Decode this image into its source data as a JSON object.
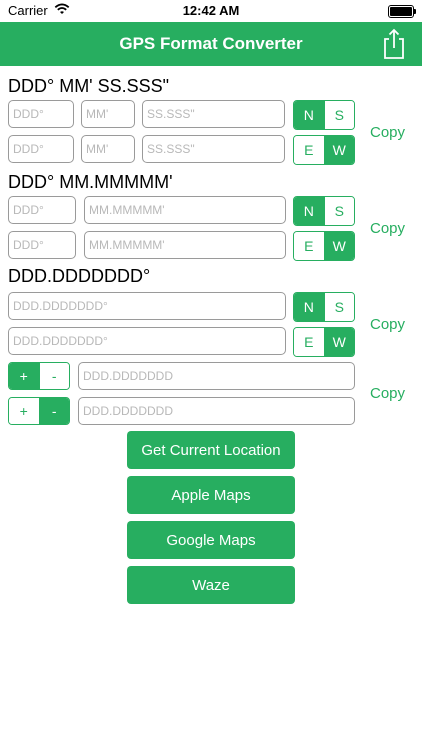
{
  "status": {
    "carrier": "Carrier",
    "time": "12:42 AM"
  },
  "nav": {
    "title": "GPS Format Converter"
  },
  "sections": {
    "dms": {
      "title": "DDD° MM' SS.SSS\"",
      "lat": {
        "deg_ph": "DDD°",
        "min_ph": "MM'",
        "sec_ph": "SS.SSS\"",
        "opts": [
          "N",
          "S"
        ],
        "selected": "N"
      },
      "lon": {
        "deg_ph": "DDD°",
        "min_ph": "MM'",
        "sec_ph": "SS.SSS\"",
        "opts": [
          "E",
          "W"
        ],
        "selected": "W"
      },
      "copy": "Copy"
    },
    "dmm": {
      "title": "DDD° MM.MMMMM'",
      "lat": {
        "deg_ph": "DDD°",
        "min_ph": "MM.MMMMM'",
        "opts": [
          "N",
          "S"
        ],
        "selected": "N"
      },
      "lon": {
        "deg_ph": "DDD°",
        "min_ph": "MM.MMMMM'",
        "opts": [
          "E",
          "W"
        ],
        "selected": "W"
      },
      "copy": "Copy"
    },
    "dd": {
      "title": "DDD.DDDDDDD°",
      "lat": {
        "deg_ph": "DDD.DDDDDDD°",
        "opts": [
          "N",
          "S"
        ],
        "selected": "N"
      },
      "lon": {
        "deg_ph": "DDD.DDDDDDD°",
        "opts": [
          "E",
          "W"
        ],
        "selected": "W"
      },
      "copy": "Copy"
    },
    "signed": {
      "lat": {
        "opts": [
          "+",
          "-"
        ],
        "selected": "+",
        "ph": "DDD.DDDDDDD"
      },
      "lon": {
        "opts": [
          "+",
          "-"
        ],
        "selected": "-",
        "ph": "DDD.DDDDDDD"
      },
      "copy": "Copy"
    }
  },
  "buttons": {
    "current_location": "Get Current Location",
    "apple_maps": "Apple Maps",
    "google_maps": "Google Maps",
    "waze": "Waze"
  },
  "colors": {
    "accent": "#27ae60"
  }
}
